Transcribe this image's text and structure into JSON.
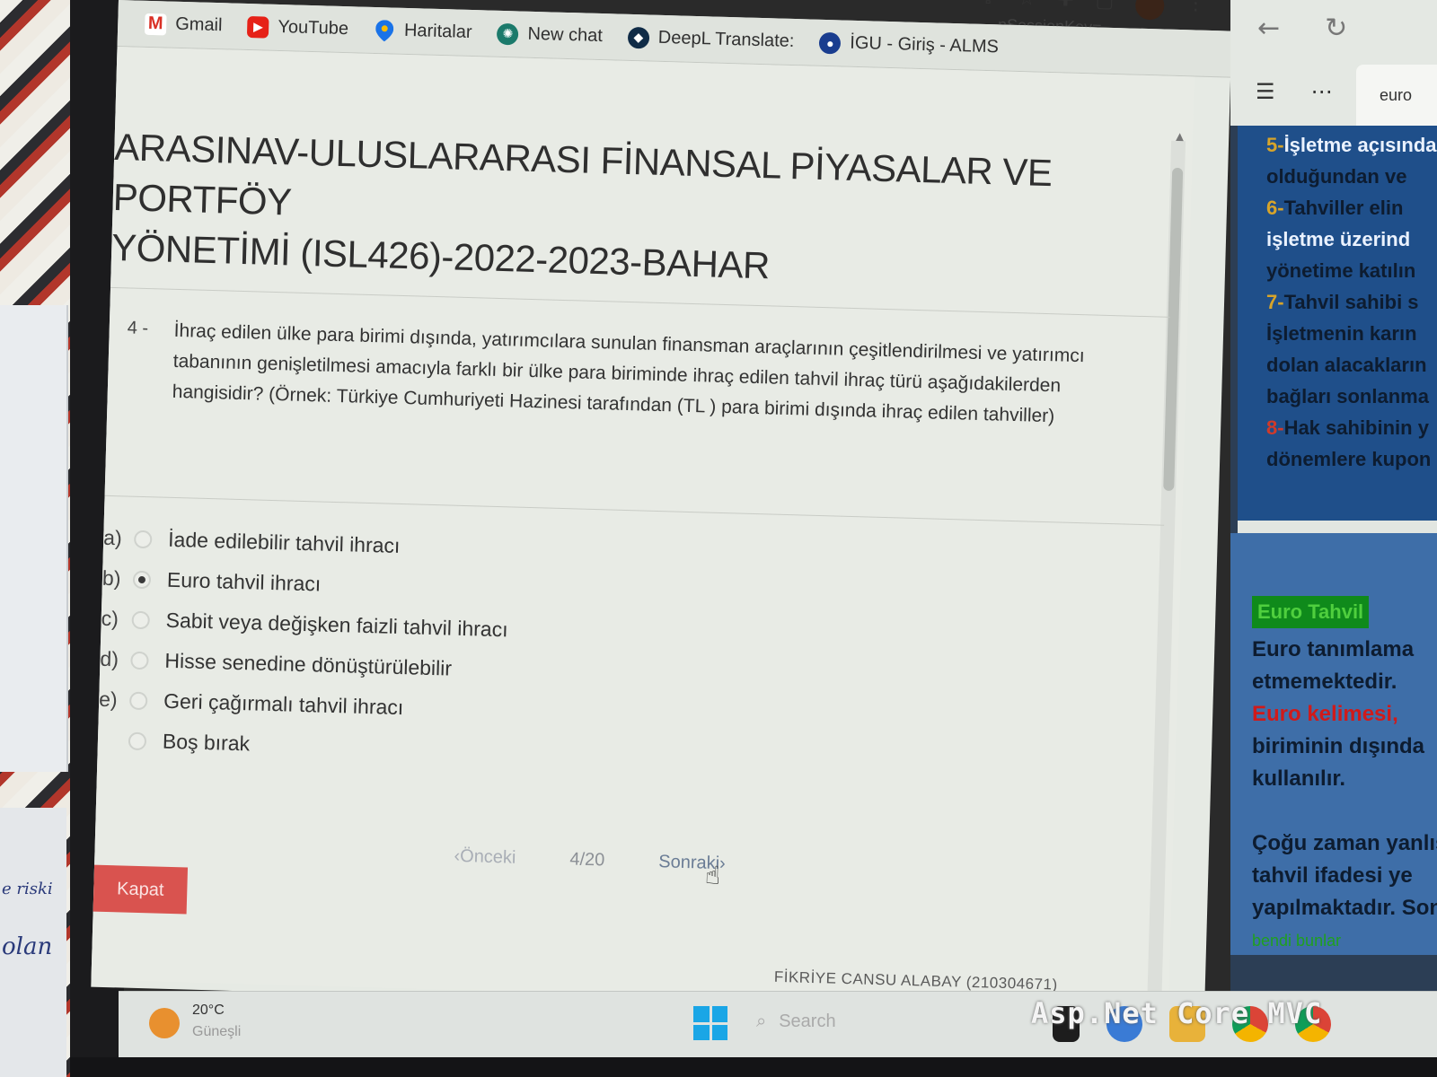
{
  "bookmarks": [
    {
      "label": "Gmail",
      "icon": "gmail-icon"
    },
    {
      "label": "YouTube",
      "icon": "youtube-icon"
    },
    {
      "label": "Haritalar",
      "icon": "maps-pin-icon"
    },
    {
      "label": "New chat",
      "icon": "chat-icon"
    },
    {
      "label": "DeepL Translate:",
      "icon": "deepl-icon"
    },
    {
      "label": "İGU - Giriş - ALMS",
      "icon": "igu-icon"
    }
  ],
  "url_fragment": "...nSessionKey=...",
  "exam": {
    "title_line1": "ARASINAV-ULUSLARARASI FİNANSAL PİYASALAR VE PORTFÖY",
    "title_line2": "YÖNETİMİ (ISL426)-2022-2023-BAHAR"
  },
  "question": {
    "number": "4 -",
    "text": "İhraç edilen ülke para birimi dışında, yatırımcılara sunulan finansman araçlarının çeşitlendirilmesi ve yatırımcı tabanının genişletilmesi amacıyla farklı bir ülke para biriminde ihraç edilen tahvil ihraç türü aşağıdakilerden hangisidir? (Örnek: Türkiye Cumhuriyeti Hazinesi tarafından (TL ) para birimi dışında ihraç edilen tahviller)",
    "options": [
      {
        "letter": "a)",
        "label": "İade edilebilir tahvil ihracı",
        "selected": false
      },
      {
        "letter": "b)",
        "label": "Euro tahvil ihracı",
        "selected": true
      },
      {
        "letter": "c)",
        "label": "Sabit veya değişken faizli tahvil ihracı",
        "selected": false
      },
      {
        "letter": "d)",
        "label": "Hisse senedine dönüştürülebilir",
        "selected": false
      },
      {
        "letter": "e)",
        "label": "Geri çağırmalı tahvil ihracı",
        "selected": false
      },
      {
        "letter": "",
        "label": "Boş bırak",
        "selected": false
      }
    ]
  },
  "pager": {
    "prev": "Önceki",
    "position": "4/20",
    "next": "Sonraki"
  },
  "close_button": "Kapat",
  "student": "FİKRİYE CANSU ALABAY (210304671)",
  "taskbar": {
    "temperature": "20°C",
    "condition": "Güneşli",
    "search_placeholder": "Search"
  },
  "side_panel": {
    "tab_label": "euro",
    "slide1_lines": [
      {
        "num": "5-",
        "text": "İşletme açısından"
      },
      {
        "num": "",
        "text": "olduğundan ve"
      },
      {
        "num": "6-",
        "text": "Tahviller elin"
      },
      {
        "num": "",
        "text": "işletme üzerind"
      },
      {
        "num": "",
        "text": "yönetime katılın"
      },
      {
        "num": "7-",
        "text": "Tahvil sahibi s"
      },
      {
        "num": "",
        "text": "İşletmenin karın"
      },
      {
        "num": "",
        "text": "dolan alacakların"
      },
      {
        "num": "",
        "text": "bağları sonlanma"
      },
      {
        "num": "8-",
        "text": "Hak sahibinin y"
      },
      {
        "num": "",
        "text": "dönemlere kupon"
      }
    ],
    "slide2_heading": "Euro Tahvil",
    "slide2_lines": [
      "Euro tanımlama",
      "etmemektedir.",
      "Euro kelimesi,",
      "biriminin dışında",
      "kullanılır.",
      "",
      "Çoğu zaman yanlış",
      "tahvil ifadesi ye",
      "yapılmaktadır. Son",
      "bendi bunlar"
    ]
  },
  "watermark": "Asp.Net Core MVC",
  "colors": {
    "close_button": "#d9534f",
    "slide_dark": "#1f4f8a",
    "slide_light": "#3e6ea8",
    "highlight_green": "#0f8a1b"
  }
}
